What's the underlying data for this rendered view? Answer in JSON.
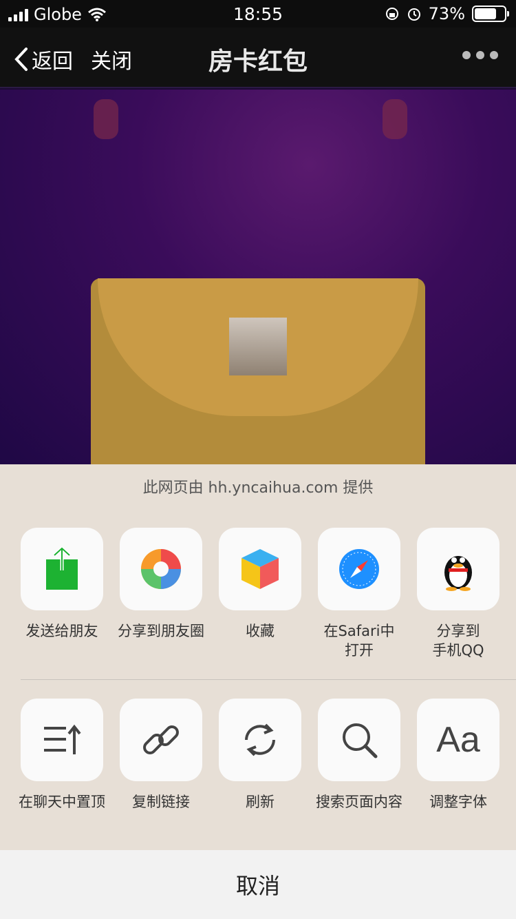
{
  "status_bar": {
    "carrier": "Globe",
    "time": "18:55",
    "battery": "73%",
    "battery_level": 0.73
  },
  "nav": {
    "back_label": "返回",
    "close_label": "关闭",
    "title": "房卡红包"
  },
  "share_sheet": {
    "provider_text": "此网页由 hh.yncaihua.com 提供",
    "row1": [
      {
        "label": "发送给朋友",
        "icon": "send-to-friend-icon"
      },
      {
        "label": "分享到朋友圈",
        "icon": "moments-icon"
      },
      {
        "label": "收藏",
        "icon": "favorite-cube-icon"
      },
      {
        "label": "在Safari中\n打开",
        "icon": "safari-compass-icon"
      },
      {
        "label": "分享到\n手机QQ",
        "icon": "qq-penguin-icon"
      }
    ],
    "row2": [
      {
        "label": "在聊天中置顶",
        "icon": "pin-top-icon"
      },
      {
        "label": "复制链接",
        "icon": "link-icon"
      },
      {
        "label": "刷新",
        "icon": "refresh-icon"
      },
      {
        "label": "搜索页面内容",
        "icon": "search-icon"
      },
      {
        "label": "调整字体",
        "icon": "font-size-icon"
      }
    ],
    "font_icon_text": "Aa",
    "cancel_label": "取消"
  }
}
